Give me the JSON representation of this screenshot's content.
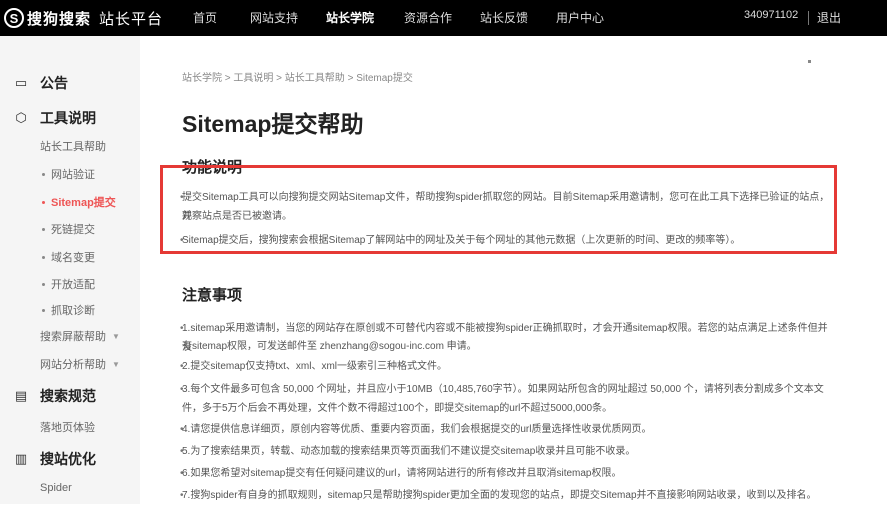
{
  "brand": {
    "logo_letter": "S",
    "name": "搜狗搜索",
    "subtitle": "站长平台"
  },
  "nav": {
    "items": [
      "首页",
      "网站支持",
      "站长学院",
      "资源合作",
      "站长反馈",
      "用户中心"
    ],
    "active": "站长学院",
    "user": "340971102",
    "logout": "退出"
  },
  "sidebar": {
    "announce": "公告",
    "tools": "工具说明",
    "tools_help": "站长工具帮助",
    "sub_items": [
      "网站验证",
      "Sitemap提交",
      "死链提交",
      "域名变更",
      "开放适配",
      "抓取诊断"
    ],
    "active_item": "Sitemap提交",
    "pc_help": "搜索屏蔽帮助",
    "analysis_help": "网站分析帮助",
    "search_norms": "搜索规范",
    "landing": "落地页体验",
    "optimize": "搜站优化",
    "spider": "Spider"
  },
  "content": {
    "breadcrumb": "站长学院 > 工具说明 > 站长工具帮助 > Sitemap提交",
    "title": "Sitemap提交帮助",
    "func_title": "功能说明",
    "func_lines": [
      "提交Sitemap工具可以向搜狗提交网站Sitemap文件，帮助搜狗spider抓取您的网站。目前Sitemap采用邀请制，您可在此工具下选择已验证的站点，并",
      "观察站点是否已被邀请。",
      "Sitemap提交后，搜狗搜索会根据Sitemap了解网站中的网址及关于每个网址的其他元数据（上次更新的时间、更改的频率等）。"
    ],
    "notes_title": "注意事项",
    "note_lines": [
      "1.sitemap采用邀请制，当您的网站存在原创或不可替代内容或不能被搜狗spider正确抓取时，才会开通sitemap权限。若您的站点满足上述条件但并没",
      "有sitemap权限，可发送邮件至 zhenzhang@sogou-inc.com 申请。",
      "2.提交sitemap仅支持txt、xml、xml一级索引三种格式文件。",
      "3.每个文件最多可包含 50,000 个网址，并且应小于10MB（10,485,760字节）。如果网站所包含的网址超过 50,000 个，请将列表分割成多个文本文",
      "件，多于5万个后会不再处理，文件个数不得超过100个，即提交sitemap的url不超过5000,000条。",
      "4.请您提供信息详细页，原创内容等优质、重要内容页面，我们会根据提交的url质量选择性收录优质网页。",
      "5.为了搜索结果页，转载、动态加载的搜索结果页等页面我们不建议提交sitemap收录并且可能不收录。",
      "6.如果您希望对sitemap提交有任何疑问建议的url，请将网站进行的所有修改并且取消sitemap权限。",
      "7.搜狗spider有自身的抓取规则，sitemap只是帮助搜狗spider更加全面的发现您的站点，即提交Sitemap并不直接影响网站收录，收到以及排名。"
    ]
  }
}
